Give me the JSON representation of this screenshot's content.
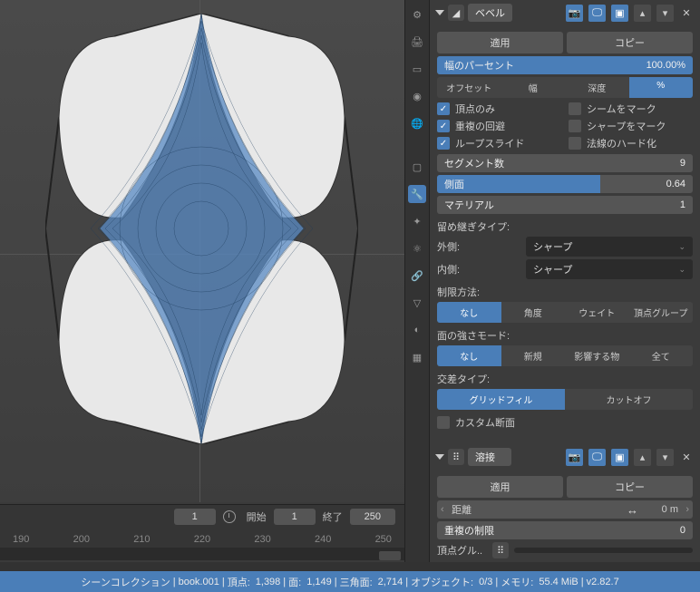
{
  "timeline": {
    "current": "1",
    "start_label": "開始",
    "start": "1",
    "end_label": "終了",
    "end": "250",
    "ticks": [
      "190",
      "200",
      "210",
      "220",
      "230",
      "240",
      "250"
    ]
  },
  "bevel": {
    "name": "ベベル",
    "apply": "適用",
    "copy": "コピー",
    "width_pct_label": "幅のパーセント",
    "width_pct_val": "100.00%",
    "amt_tabs": {
      "offset": "オフセット",
      "width": "幅",
      "depth": "深度",
      "percent": "%"
    },
    "checks": {
      "vertices_only": "頂点のみ",
      "mark_seam": "シームをマーク",
      "clamp_overlap": "重複の回避",
      "mark_sharp": "シャープをマーク",
      "loop_slide": "ループスライド",
      "harden_normals": "法線のハード化"
    },
    "segments_label": "セグメント数",
    "segments_val": "9",
    "profile_label": "側面",
    "profile_val": "0.64",
    "material_label": "マテリアル",
    "material_val": "1",
    "miter_label": "留め継ぎタイプ:",
    "outer_label": "外側:",
    "outer_val": "シャープ",
    "inner_label": "内側:",
    "inner_val": "シャープ",
    "limit_label": "制限方法:",
    "limit_tabs": {
      "none": "なし",
      "angle": "角度",
      "weight": "ウェイト",
      "vgroup": "頂点グループ"
    },
    "strength_label": "面の強さモード:",
    "strength_tabs": {
      "none": "なし",
      "new": "新規",
      "affected": "影響する物",
      "all": "全て"
    },
    "intersect_label": "交差タイプ:",
    "intersect_tabs": {
      "grid": "グリッドフィル",
      "cutoff": "カットオフ"
    },
    "custom_profile": "カスタム断面"
  },
  "weld": {
    "name": "溶接",
    "apply": "適用",
    "copy": "コピー",
    "distance_label": "距離",
    "distance_val": "0 m",
    "dup_limit_label": "重複の制限",
    "dup_limit_val": "0",
    "vgroup_label": "頂点グル.."
  },
  "status": {
    "collection": "シーンコレクション",
    "object": "book.001",
    "verts_l": "頂点:",
    "verts_v": "1,398",
    "faces_l": "面:",
    "faces_v": "1,149",
    "tris_l": "三角面:",
    "tris_v": "2,714",
    "objs_l": "オブジェクト:",
    "objs_v": "0/3",
    "mem_l": "メモリ:",
    "mem_v": "55.4 MiB",
    "ver": "v2.82.7"
  }
}
